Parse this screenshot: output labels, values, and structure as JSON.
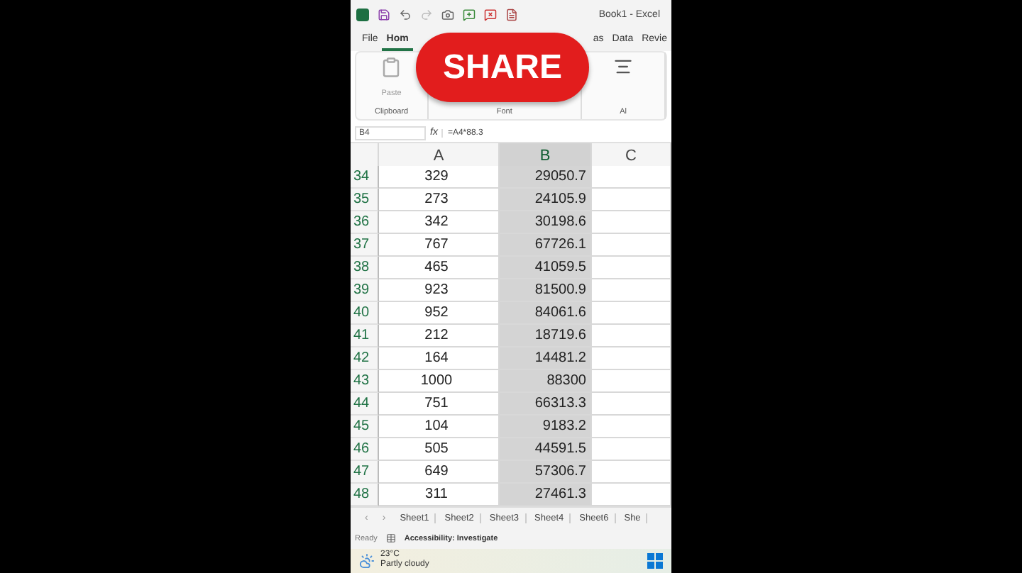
{
  "window": {
    "title": "Book1 - Excel"
  },
  "ribbon_tabs": [
    {
      "label": "File",
      "selected": false
    },
    {
      "label": "Hom",
      "selected": true
    },
    {
      "label": "as",
      "selected": false
    },
    {
      "label": "Data",
      "selected": false
    },
    {
      "label": "Revie",
      "selected": false
    }
  ],
  "ribbon": {
    "paste_label": "Paste",
    "groups": [
      "Clipboard",
      "Font",
      "Al"
    ]
  },
  "formula_bar": {
    "name_box": "B4",
    "fx": "fx",
    "formula": "=A4*88.3"
  },
  "columns": [
    {
      "label": "A",
      "selected": false
    },
    {
      "label": "B",
      "selected": true
    },
    {
      "label": "C",
      "selected": false
    }
  ],
  "rows": [
    {
      "number": "34",
      "a": "329",
      "b": "29050.7"
    },
    {
      "number": "35",
      "a": "273",
      "b": "24105.9"
    },
    {
      "number": "36",
      "a": "342",
      "b": "30198.6"
    },
    {
      "number": "37",
      "a": "767",
      "b": "67726.1"
    },
    {
      "number": "38",
      "a": "465",
      "b": "41059.5"
    },
    {
      "number": "39",
      "a": "923",
      "b": "81500.9"
    },
    {
      "number": "40",
      "a": "952",
      "b": "84061.6"
    },
    {
      "number": "41",
      "a": "212",
      "b": "18719.6"
    },
    {
      "number": "42",
      "a": "164",
      "b": "14481.2"
    },
    {
      "number": "43",
      "a": "1000",
      "b": "88300"
    },
    {
      "number": "44",
      "a": "751",
      "b": "66313.3"
    },
    {
      "number": "45",
      "a": "104",
      "b": "9183.2"
    },
    {
      "number": "46",
      "a": "505",
      "b": "44591.5"
    },
    {
      "number": "47",
      "a": "649",
      "b": "57306.7"
    },
    {
      "number": "48",
      "a": "311",
      "b": "27461.3"
    }
  ],
  "sheet_nav": [
    "‹",
    "›"
  ],
  "sheet_tabs": [
    {
      "label": "Sheet1"
    },
    {
      "label": "Sheet2"
    },
    {
      "label": "Sheet3"
    },
    {
      "label": "Sheet4"
    },
    {
      "label": "Sheet6"
    },
    {
      "label": "She"
    }
  ],
  "status_bar": {
    "mode": "Ready",
    "accessibility": "Accessibility: Investigate"
  },
  "taskbar": {
    "temperature": "23°C",
    "weather": "Partly cloudy"
  },
  "overlay": {
    "label": "SHARE"
  }
}
